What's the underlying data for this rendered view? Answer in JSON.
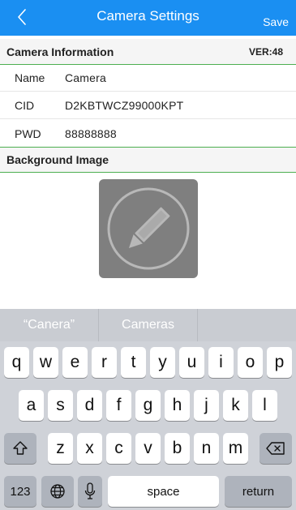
{
  "navbar": {
    "title": "Camera Settings",
    "save_label": "Save",
    "back_icon": "chevron-left-icon",
    "bg_color": "#1a8ff2"
  },
  "camera_info": {
    "header": "Camera Information",
    "version": "VER:48",
    "rows": [
      {
        "key": "Name",
        "value": "Camera"
      },
      {
        "key": "CID",
        "value": "D2KBTWCZ99000KPT"
      },
      {
        "key": "PWD",
        "value": "88888888"
      }
    ]
  },
  "background": {
    "header": "Background Image",
    "edit_icon": "pencil-icon"
  },
  "keyboard": {
    "suggestions": [
      "“Canera”",
      "Cameras",
      ""
    ],
    "row1": [
      "q",
      "w",
      "e",
      "r",
      "t",
      "y",
      "u",
      "i",
      "o",
      "p"
    ],
    "row2": [
      "a",
      "s",
      "d",
      "f",
      "g",
      "h",
      "j",
      "k",
      "l"
    ],
    "row3": [
      "z",
      "x",
      "c",
      "v",
      "b",
      "n",
      "m"
    ],
    "numbers_label": "123",
    "space_label": "space",
    "return_label": "return",
    "shift_icon": "shift-icon",
    "delete_icon": "backspace-icon",
    "globe_icon": "globe-icon",
    "mic_icon": "microphone-icon"
  }
}
